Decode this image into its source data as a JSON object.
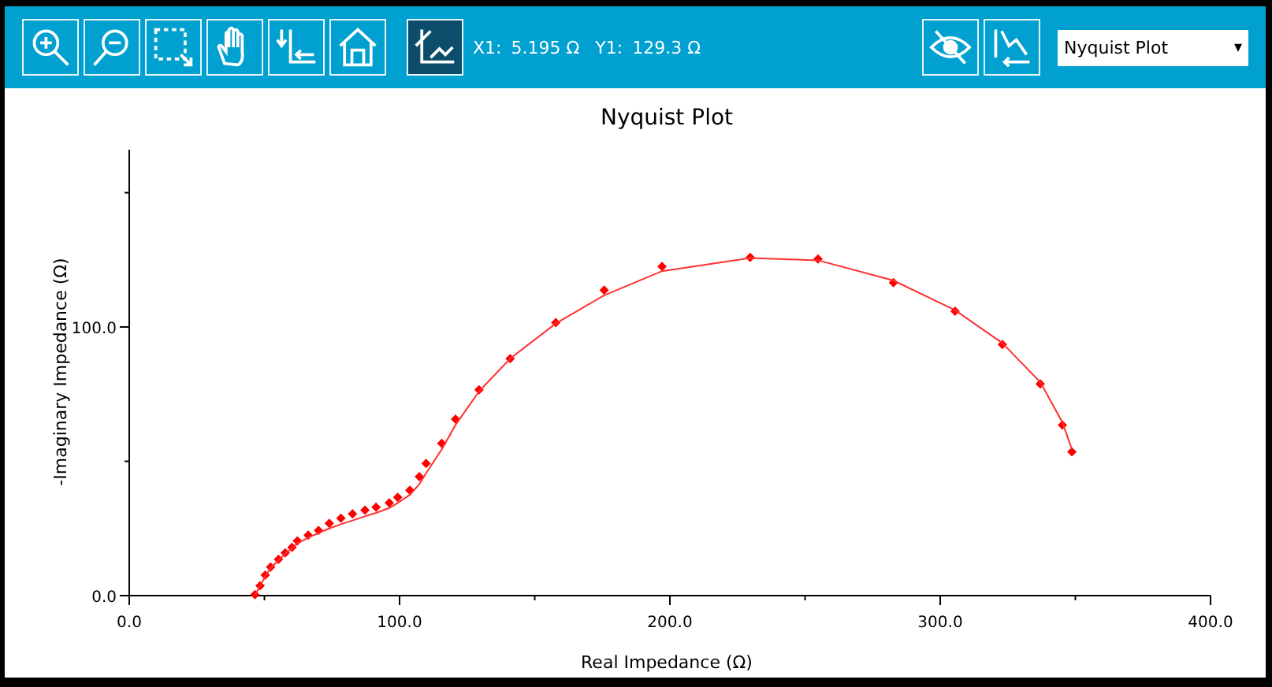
{
  "toolbar": {
    "tools": [
      {
        "kind": "zoom-in",
        "selected": false
      },
      {
        "kind": "zoom-out",
        "selected": false
      },
      {
        "kind": "select",
        "selected": false
      },
      {
        "kind": "pan",
        "selected": false
      },
      {
        "kind": "axes",
        "selected": false
      },
      {
        "kind": "home",
        "selected": false
      },
      {
        "kind": "cursor",
        "selected": true
      }
    ],
    "cursor_readout": [
      {
        "label": "X1:",
        "value": "5.195 Ω"
      },
      {
        "label": "Y1:",
        "value": "129.3 Ω"
      }
    ],
    "right_tools": [
      {
        "kind": "hide"
      },
      {
        "kind": "chart-options"
      }
    ],
    "plot_select": {
      "value": "Nyquist Plot",
      "arrow": "▾"
    }
  },
  "chart": {
    "chart_data": {
      "type": "scatter",
      "title": "Nyquist Plot",
      "xlabel": "Real Impedance (Ω)",
      "ylabel": "-Imaginary Impedance (Ω)",
      "x": [
        46.5,
        48.4,
        50.3,
        52.3,
        55.2,
        57.7,
        60.2,
        62.2,
        66.2,
        70,
        74,
        78.3,
        82.6,
        87.2,
        91.3,
        96.2,
        99.3,
        103.8,
        107.3,
        109.8,
        115.6,
        120.7,
        129.4,
        140.9,
        157.8,
        175.7,
        197.1,
        229.7,
        254.8,
        282.7,
        305.5,
        323,
        337,
        345.2,
        348.7
      ],
      "series": [
        {
          "type": "scatter",
          "color": "#ff0000",
          "values": [
            0.4,
            3.7,
            7.6,
            10.6,
            13.5,
            15.9,
            18,
            20.4,
            22.5,
            24.3,
            26.9,
            28.8,
            30.4,
            31.8,
            32.9,
            34.5,
            36.6,
            39.2,
            44.3,
            49.2,
            56.7,
            65.7,
            76.6,
            88.2,
            101.6,
            113.7,
            122.5,
            125.9,
            125.3,
            116.5,
            105.9,
            93.5,
            78.8,
            63.5,
            53.5
          ]
        },
        {
          "type": "line",
          "color": "#ff3030",
          "values": [
            0.2,
            3.5,
            7.2,
            10.2,
            13.2,
            15.6,
            17.6,
            19.4,
            21.6,
            23.3,
            25,
            26.6,
            28,
            29.5,
            30.8,
            32.6,
            34.5,
            37.5,
            41.5,
            45.5,
            54.5,
            63.5,
            76,
            88.2,
            101.3,
            111.8,
            120.8,
            125.7,
            124.8,
            117.3,
            106.3,
            94,
            79.5,
            64.5,
            54.5
          ]
        }
      ],
      "xlim": [
        0,
        400
      ],
      "ylim": [
        0,
        166
      ],
      "xticks": [
        {
          "value": 0,
          "label": "0.0"
        },
        {
          "value": 100,
          "label": "100.0"
        },
        {
          "value": 200,
          "label": "200.0"
        },
        {
          "value": 300,
          "label": "300.0"
        },
        {
          "value": 400,
          "label": "400.0"
        }
      ],
      "yticks": [
        {
          "value": 0,
          "label": "0.0"
        },
        {
          "value": 100,
          "label": "100.0"
        }
      ]
    }
  }
}
